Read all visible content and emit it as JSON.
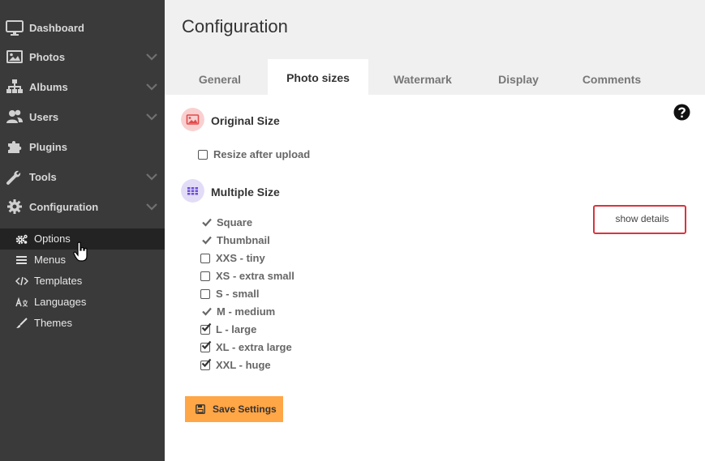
{
  "sidebar": {
    "items": [
      {
        "label": "Dashboard",
        "icon": "monitor-icon",
        "has_chevron": false
      },
      {
        "label": "Photos",
        "icon": "image-icon",
        "has_chevron": true
      },
      {
        "label": "Albums",
        "icon": "sitemap-icon",
        "has_chevron": true
      },
      {
        "label": "Users",
        "icon": "users-icon",
        "has_chevron": true
      },
      {
        "label": "Plugins",
        "icon": "puzzle-icon",
        "has_chevron": false
      },
      {
        "label": "Tools",
        "icon": "wrench-icon",
        "has_chevron": true
      },
      {
        "label": "Configuration",
        "icon": "gear-icon",
        "has_chevron": true
      }
    ],
    "sub_items": [
      {
        "label": "Options",
        "icon": "cogs-icon",
        "active": true
      },
      {
        "label": "Menus",
        "icon": "bars-icon",
        "active": false
      },
      {
        "label": "Templates",
        "icon": "code-icon",
        "active": false
      },
      {
        "label": "Languages",
        "icon": "language-icon",
        "active": false
      },
      {
        "label": "Themes",
        "icon": "brush-icon",
        "active": false
      }
    ]
  },
  "page": {
    "title": "Configuration"
  },
  "tabs": [
    {
      "label": "General",
      "active": false
    },
    {
      "label": "Photo sizes",
      "active": true
    },
    {
      "label": "Watermark",
      "active": false
    },
    {
      "label": "Display",
      "active": false
    },
    {
      "label": "Comments",
      "active": false
    }
  ],
  "original_size": {
    "title": "Original Size",
    "resize_label": "Resize after upload",
    "resize_checked": false
  },
  "multiple_size": {
    "title": "Multiple Size",
    "show_details": "show details",
    "sizes": [
      {
        "label": "Square",
        "state": "fixed"
      },
      {
        "label": "Thumbnail",
        "state": "fixed"
      },
      {
        "label": "XXS - tiny",
        "state": "unchecked"
      },
      {
        "label": "XS - extra small",
        "state": "unchecked"
      },
      {
        "label": "S - small",
        "state": "unchecked"
      },
      {
        "label": "M - medium",
        "state": "fixed"
      },
      {
        "label": "L - large",
        "state": "checked"
      },
      {
        "label": "XL - extra large",
        "state": "checked"
      },
      {
        "label": "XXL - huge",
        "state": "checked"
      }
    ]
  },
  "save_button": {
    "label": "Save Settings",
    "icon": "floppy-icon"
  },
  "colors": {
    "sidebar_bg": "#3a3a3a",
    "active_sub_bg": "#232323",
    "save_button": "#ffa646",
    "highlight_border": "#d9343e",
    "original_icon_bg": "#f9d0d0",
    "multiple_icon_bg": "#e3dcf7"
  }
}
